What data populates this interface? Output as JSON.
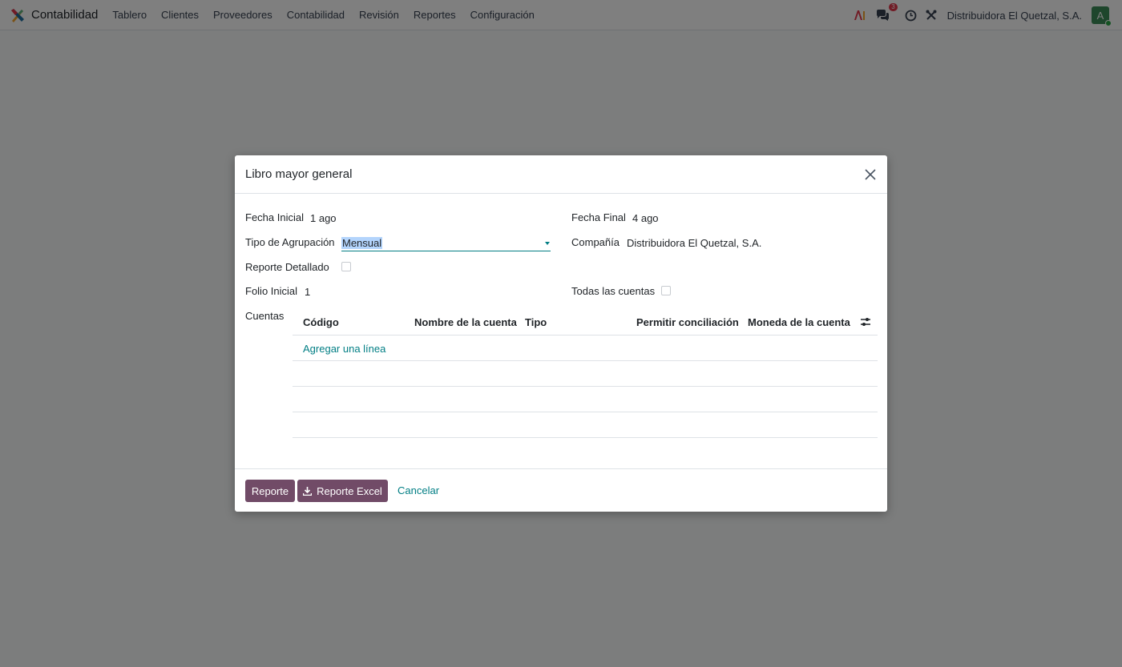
{
  "navbar": {
    "app_name": "Contabilidad",
    "menu": [
      "Tablero",
      "Clientes",
      "Proveedores",
      "Contabilidad",
      "Revisión",
      "Reportes",
      "Configuración"
    ],
    "messages_badge": "3",
    "company": "Distribuidora El Quetzal, S.A.",
    "avatar_letter": "A"
  },
  "modal": {
    "title": "Libro mayor general",
    "fields": {
      "fecha_inicial_label": "Fecha Inicial",
      "fecha_inicial_value": "1 ago",
      "fecha_final_label": "Fecha Final",
      "fecha_final_value": "4 ago",
      "tipo_agrupacion_label": "Tipo de Agrupación",
      "tipo_agrupacion_value": "Mensual",
      "compania_label": "Compañía",
      "compania_value": "Distribuidora El Quetzal, S.A.",
      "reporte_detallado_label": "Reporte Detallado",
      "reporte_detallado_checked": false,
      "folio_inicial_label": "Folio Inicial",
      "folio_inicial_value": "1",
      "todas_cuentas_label": "Todas las cuentas",
      "todas_cuentas_checked": false,
      "cuentas_label": "Cuentas"
    },
    "table": {
      "columns": [
        "Código",
        "Nombre de la cuenta",
        "Tipo",
        "Permitir conciliación",
        "Moneda de la cuenta"
      ],
      "add_line": "Agregar una línea"
    },
    "buttons": {
      "reporte": "Reporte",
      "reporte_excel": "Reporte Excel",
      "cancelar": "Cancelar"
    }
  },
  "colors": {
    "primary": "#714b67",
    "link": "#017e84",
    "badge": "#e2364a",
    "avatar": "#3c8d58"
  }
}
